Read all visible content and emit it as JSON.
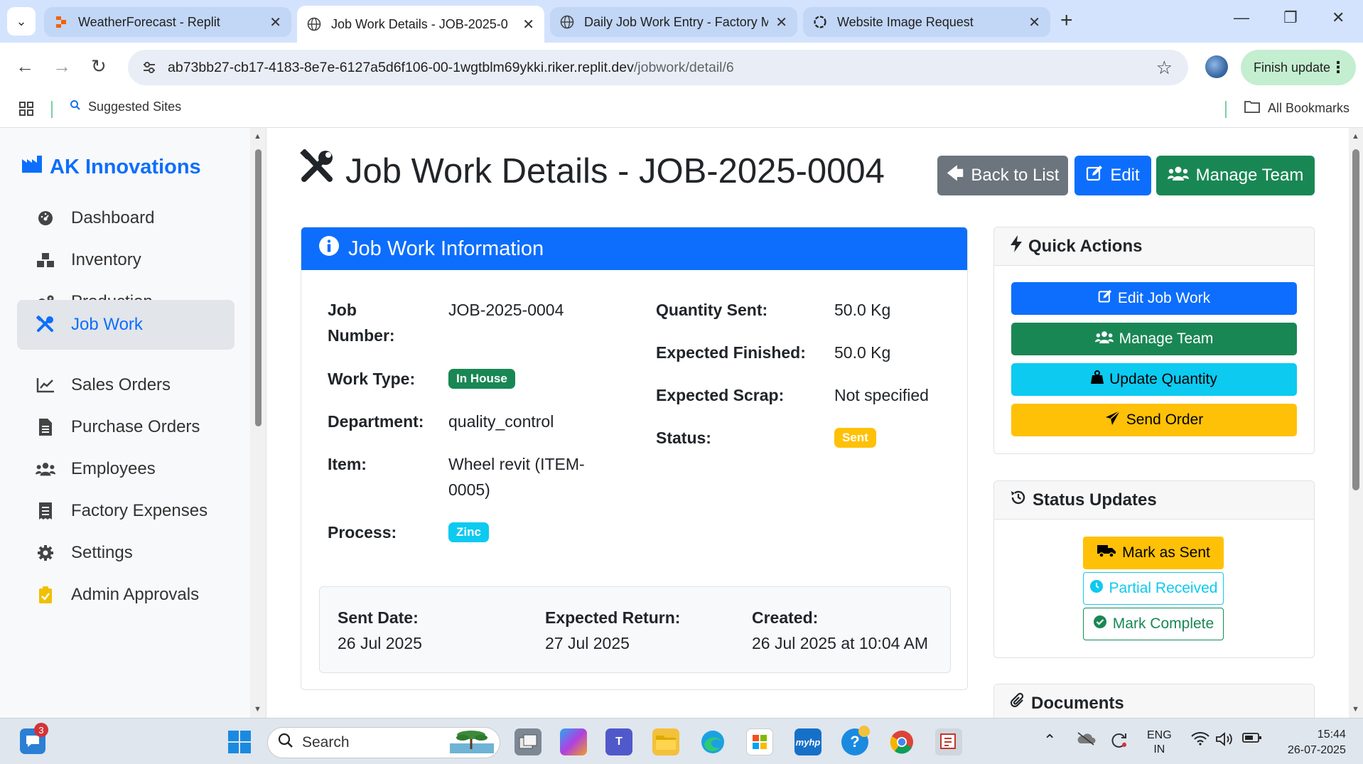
{
  "browser": {
    "tabs": [
      {
        "title": "WeatherForecast - Replit",
        "active": false
      },
      {
        "title": "Job Work Details - JOB-2025-0",
        "active": true
      },
      {
        "title": "Daily Job Work Entry - Factory M",
        "active": false
      },
      {
        "title": "Website Image Request",
        "active": false
      }
    ],
    "url_host": "ab73bb27-cb17-4183-8e7e-6127a5d6f106-00-1wgtblm69ykki.riker.replit.dev",
    "url_path": "/jobwork/detail/6",
    "finish_update": "Finish update",
    "bookmarks": {
      "suggested": "Suggested Sites",
      "all": "All Bookmarks"
    }
  },
  "sidebar": {
    "brand": "AK Innovations",
    "items": [
      {
        "label": "Dashboard",
        "icon": "dashboard-icon"
      },
      {
        "label": "Inventory",
        "icon": "boxes-icon"
      },
      {
        "label": "Production",
        "icon": "cogs-icon"
      },
      {
        "label": "Job Work",
        "icon": "tools-icon",
        "active": true
      },
      {
        "label": "Sales Orders",
        "icon": "chart-line-icon"
      },
      {
        "label": "Purchase Orders",
        "icon": "file-icon"
      },
      {
        "label": "Employees",
        "icon": "users-icon"
      },
      {
        "label": "Factory Expenses",
        "icon": "receipt-icon"
      },
      {
        "label": "Settings",
        "icon": "gear-icon"
      },
      {
        "label": "Admin Approvals",
        "icon": "clipboard-check-icon"
      }
    ]
  },
  "header": {
    "title": "Job Work Details - JOB-2025-0004",
    "back_label": "Back to List",
    "edit_label": "Edit",
    "team_label": "Manage Team"
  },
  "info": {
    "title": "Job Work Information",
    "job_number_label_1": "Job",
    "job_number_label_2": "Number:",
    "job_number": "JOB-2025-0004",
    "work_type_label": "Work Type:",
    "work_type": "In House",
    "department_label": "Department:",
    "department": "quality_control",
    "item_label": "Item:",
    "item_line1": "Wheel revit (ITEM-",
    "item_line2": "0005)",
    "process_label": "Process:",
    "process": "Zinc",
    "qty_sent_label": "Quantity Sent:",
    "qty_sent": "50.0 Kg",
    "exp_finished_label": "Expected Finished:",
    "exp_finished": "50.0 Kg",
    "exp_scrap_label": "Expected Scrap:",
    "exp_scrap": "Not specified",
    "status_label": "Status:",
    "status": "Sent",
    "sent_date_label": "Sent Date:",
    "sent_date": "26 Jul 2025",
    "exp_return_label": "Expected Return:",
    "exp_return": "27 Jul 2025",
    "created_label": "Created:",
    "created": "26 Jul 2025 at 10:04 AM"
  },
  "quick_actions": {
    "title": "Quick Actions",
    "edit": "Edit Job Work",
    "team": "Manage Team",
    "update_qty": "Update Quantity",
    "send": "Send Order"
  },
  "status_updates": {
    "title": "Status Updates",
    "mark_sent": "Mark as Sent",
    "partial": "Partial Received",
    "complete": "Mark Complete"
  },
  "documents": {
    "title": "Documents"
  },
  "taskbar": {
    "search": "Search",
    "lang": "ENG",
    "region": "IN",
    "time": "15:44",
    "date": "26-07-2025",
    "notif_count": "3"
  },
  "colors": {
    "primary": "#0d6efd",
    "success": "#198754",
    "secondary": "#6c757d",
    "info": "#0dcaf0",
    "warning": "#ffc107"
  }
}
